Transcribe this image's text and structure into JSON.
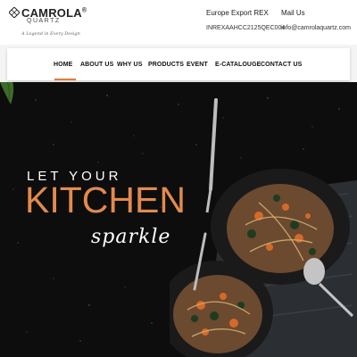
{
  "header": {
    "brand_name": "CAMROLA",
    "brand_reg": "®",
    "brand_sub": "QUARTZ",
    "brand_tagline": "A Legend in Every Design",
    "export_title": "Europe Export REX",
    "export_value": "INREXAAHCC2125QEC004",
    "mail_title": "Mail Us",
    "mail_value": "info@camrolaquartz.com"
  },
  "nav": {
    "items": [
      {
        "label": "HOME",
        "active": true
      },
      {
        "label": "ABOUT US"
      },
      {
        "label": "WHY US"
      },
      {
        "label": "PRODUCTS"
      },
      {
        "label": "EVENT"
      },
      {
        "label": "E-CATALOUGE"
      },
      {
        "label": "CONTACT US"
      }
    ]
  },
  "hero": {
    "line1": "LET YOUR",
    "line2": "KITCHEN",
    "line3": "sparkle"
  },
  "colors": {
    "accent": "#e38a4d",
    "hero_bg": "#0d0d0d",
    "nav_active_underline": "#e07b39"
  },
  "icons": {
    "logo": "camrola-logo-mark-icon"
  }
}
